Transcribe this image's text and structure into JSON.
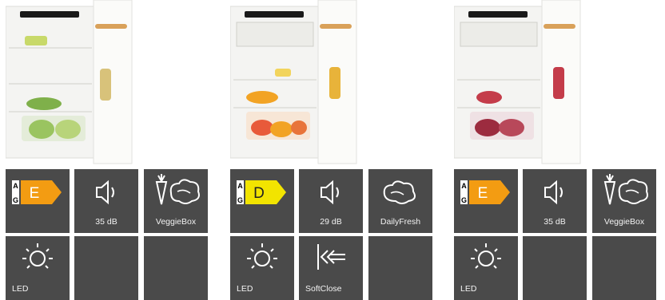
{
  "products": [
    {
      "energy_class": "E",
      "energy_scale_top": "A",
      "energy_scale_bottom": "G",
      "energy_color": "#f39c12",
      "noise_label": "35 dB",
      "feature_label": "VeggieBox",
      "feature_icon": "veggiebox-icon",
      "light_label": "LED",
      "extra_label": null,
      "produce_colors": [
        "#8fc14a",
        "#b9d66b",
        "#d8e7a3"
      ]
    },
    {
      "energy_class": "D",
      "energy_scale_top": "A",
      "energy_scale_bottom": "G",
      "energy_color": "#f2e400",
      "noise_label": "29 dB",
      "feature_label": "DailyFresh",
      "feature_icon": "dailyfresh-icon",
      "light_label": "LED",
      "extra_label": "SoftClose",
      "produce_colors": [
        "#f2a324",
        "#e85a3a",
        "#f7d15c"
      ]
    },
    {
      "energy_class": "E",
      "energy_scale_top": "A",
      "energy_scale_bottom": "G",
      "energy_color": "#f39c12",
      "noise_label": "35 dB",
      "feature_label": "VeggieBox",
      "feature_icon": "veggiebox-icon",
      "light_label": "LED",
      "extra_label": null,
      "produce_colors": [
        "#c43c4a",
        "#9c2b3f",
        "#e07a8a"
      ]
    }
  ]
}
